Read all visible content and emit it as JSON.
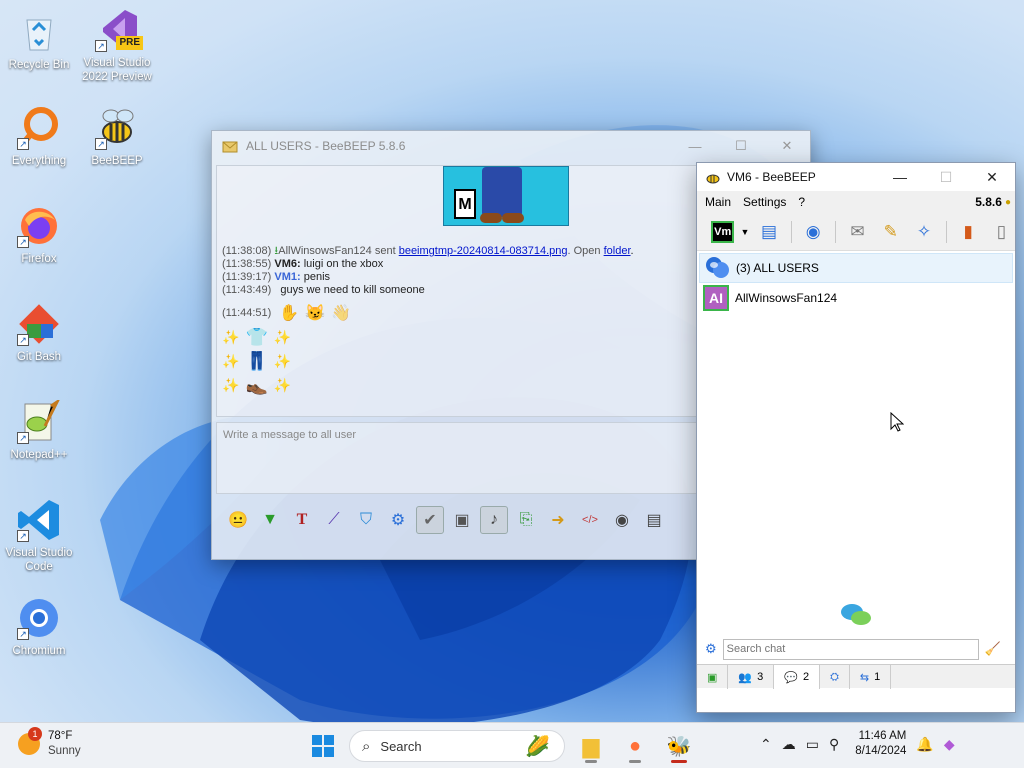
{
  "desktop": {
    "icons": [
      {
        "label": "Recycle Bin"
      },
      {
        "label": "Visual Studio 2022 Preview",
        "badge": "PRE"
      },
      {
        "label": "Everything"
      },
      {
        "label": "BeeBEEP"
      },
      {
        "label": "Firefox"
      },
      {
        "label": "Git Bash"
      },
      {
        "label": "Notepad++"
      },
      {
        "label": "Visual Studio Code"
      },
      {
        "label": "Chromium"
      }
    ]
  },
  "chat_window": {
    "title": "ALL USERS - BeeBEEP 5.8.6",
    "messages": [
      {
        "time": "(11:38:08)",
        "prefix": "AllWinsowsFan124 sent ",
        "link": "beeimgtmp-20240814-083714.png",
        "mid": ". Open ",
        "link2": "folder",
        "suffix": "."
      },
      {
        "time": "(11:38:55)",
        "user": "VM6:",
        "text": " luigi on the xbox"
      },
      {
        "time": "(11:39:17)",
        "user": "VM1:",
        "text": " penis"
      },
      {
        "time": "(11:43:49)",
        "user": "",
        "text": "guys we need to kill someone"
      },
      {
        "time": "(11:44:51)"
      }
    ],
    "input_placeholder": "Write a message to all user",
    "image_rating": "M"
  },
  "main_window": {
    "title": "VM6 - BeeBEEP",
    "menu": [
      "Main",
      "Settings",
      "?"
    ],
    "version": "5.8.6",
    "toolbar_badge": "Vm",
    "users": [
      {
        "label": "(3) ALL USERS"
      },
      {
        "label": "AllWinsowsFan124",
        "avatar": "AI"
      }
    ],
    "search_placeholder": "Search chat",
    "tabs": [
      {
        "count": ""
      },
      {
        "count": "3"
      },
      {
        "count": "2"
      },
      {
        "count": ""
      },
      {
        "count": "1"
      }
    ]
  },
  "taskbar": {
    "weather_temp": "78°F",
    "weather_cond": "Sunny",
    "weather_badge": "1",
    "search_label": "Search",
    "time": "11:46 AM",
    "date": "8/14/2024"
  }
}
